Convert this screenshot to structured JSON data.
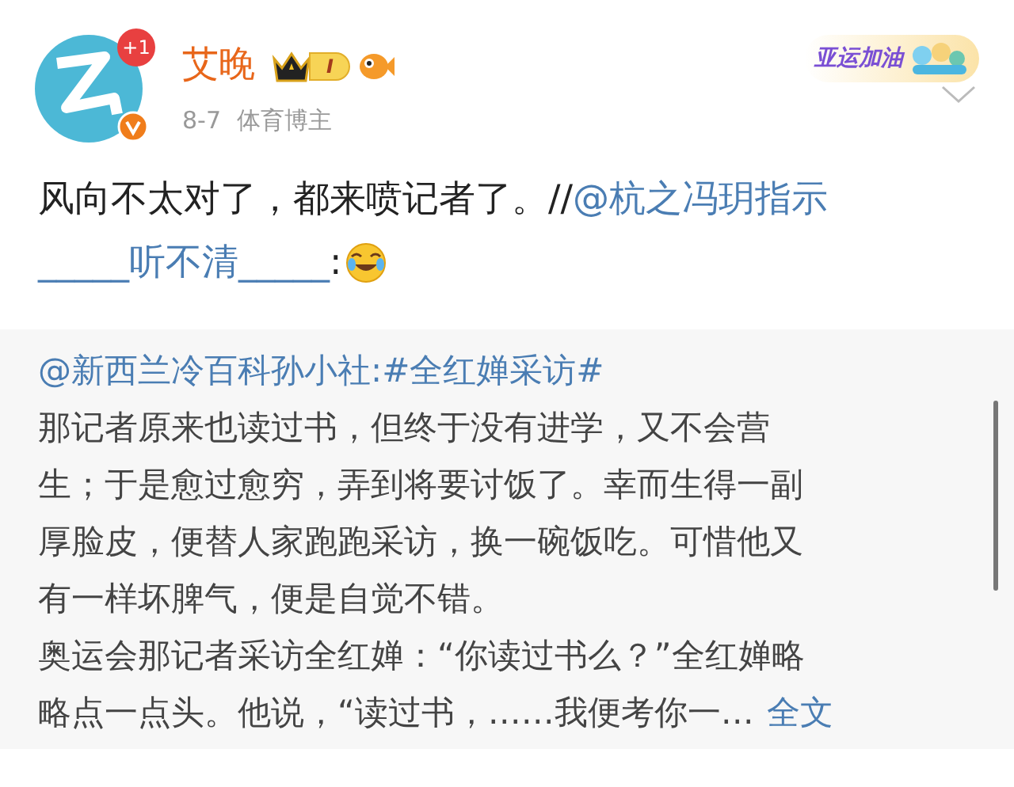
{
  "post": {
    "avatar_badge": "+1",
    "verified": true,
    "author": "艾晚",
    "level_badge": "I",
    "date": "8-7",
    "author_tag": "体育博主",
    "sticker": "亚运加油",
    "text_lines": [
      [
        {
          "kind": "text",
          "text": "风向不太对了，都来喷记者了。//"
        },
        {
          "kind": "mention",
          "text": "@杭之冯玥指示"
        }
      ],
      [
        {
          "kind": "mention",
          "text": "_____听不清_____"
        },
        {
          "kind": "text",
          "text": ":"
        },
        {
          "kind": "emoji"
        }
      ]
    ]
  },
  "repost": {
    "source": "@新西兰冷百科孙小社:#全红婵采访#",
    "lines": [
      "那记者原来也读过书，但终于没有进学，又不会营",
      "生；于是愈过愈穷，弄到将要讨饭了。幸而生得一副",
      "厚脸皮，便替人家跑跑采访，换一碗饭吃。可惜他又",
      "有一样坏脾气，便是自觉不错。",
      "奥运会那记者采访全红婵：“你读过书么？”全红婵略",
      "略点一点头。他说，“读过书，……我便考你一…"
    ],
    "more_link": "全文"
  }
}
